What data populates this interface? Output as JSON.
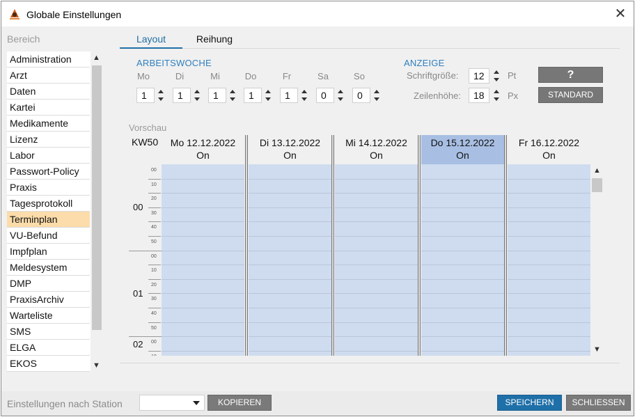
{
  "window": {
    "title": "Globale Einstellungen",
    "app_icon": "app-logo-icon",
    "close_icon": "close-icon"
  },
  "sidebar": {
    "label": "Bereich",
    "items": [
      "Administration",
      "Arzt",
      "Daten",
      "Kartei",
      "Medikamente",
      "Lizenz",
      "Labor",
      "Passwort-Policy",
      "Praxis",
      "Tagesprotokoll",
      "Terminplan",
      "VU-Befund",
      "Impfplan",
      "Meldesystem",
      "DMP",
      "PraxisArchiv",
      "Warteliste",
      "SMS",
      "ELGA",
      "EKOS"
    ],
    "selected": "Terminplan"
  },
  "tabs": [
    {
      "label": "Layout",
      "active": true
    },
    {
      "label": "Reihung",
      "active": false
    }
  ],
  "arbeitswoche": {
    "title": "ARBEITSWOCHE",
    "days": [
      {
        "label": "Mo",
        "value": "1"
      },
      {
        "label": "Di",
        "value": "1"
      },
      {
        "label": "Mi",
        "value": "1"
      },
      {
        "label": "Do",
        "value": "1"
      },
      {
        "label": "Fr",
        "value": "1"
      },
      {
        "label": "Sa",
        "value": "0"
      },
      {
        "label": "So",
        "value": "0"
      }
    ]
  },
  "anzeige": {
    "title": "ANZEIGE",
    "font_size_label": "Schriftgröße:",
    "font_size_value": "12",
    "font_size_unit": "Pt",
    "row_height_label": "Zeilenhöhe:",
    "row_height_value": "18",
    "row_height_unit": "Px",
    "help_button": "?",
    "standard_button": "STANDARD"
  },
  "preview": {
    "label": "Vorschau",
    "week": "KW50",
    "columns": [
      {
        "date": "Mo 12.12.2022",
        "status": "On",
        "highlighted": false
      },
      {
        "date": "Di 13.12.2022",
        "status": "On",
        "highlighted": false
      },
      {
        "date": "Mi 14.12.2022",
        "status": "On",
        "highlighted": false
      },
      {
        "date": "Do 15.12.2022",
        "status": "On",
        "highlighted": true
      },
      {
        "date": "Fr 16.12.2022",
        "status": "On",
        "highlighted": false
      }
    ],
    "hours": [
      "00",
      "01",
      "02"
    ],
    "minutes": [
      "00",
      "10",
      "20",
      "30",
      "40",
      "50"
    ]
  },
  "bottom": {
    "station_label": "Einstellungen nach Station",
    "station_value": "",
    "copy_button": "KOPIEREN",
    "save_button": "SPEICHERN",
    "close_button": "SCHLIESSEN"
  },
  "colors": {
    "accent": "#1f6fa8",
    "selected_item": "#fbdcaa",
    "calendar_bg": "#cfdcef",
    "calendar_highlight": "#a8bfe3"
  }
}
